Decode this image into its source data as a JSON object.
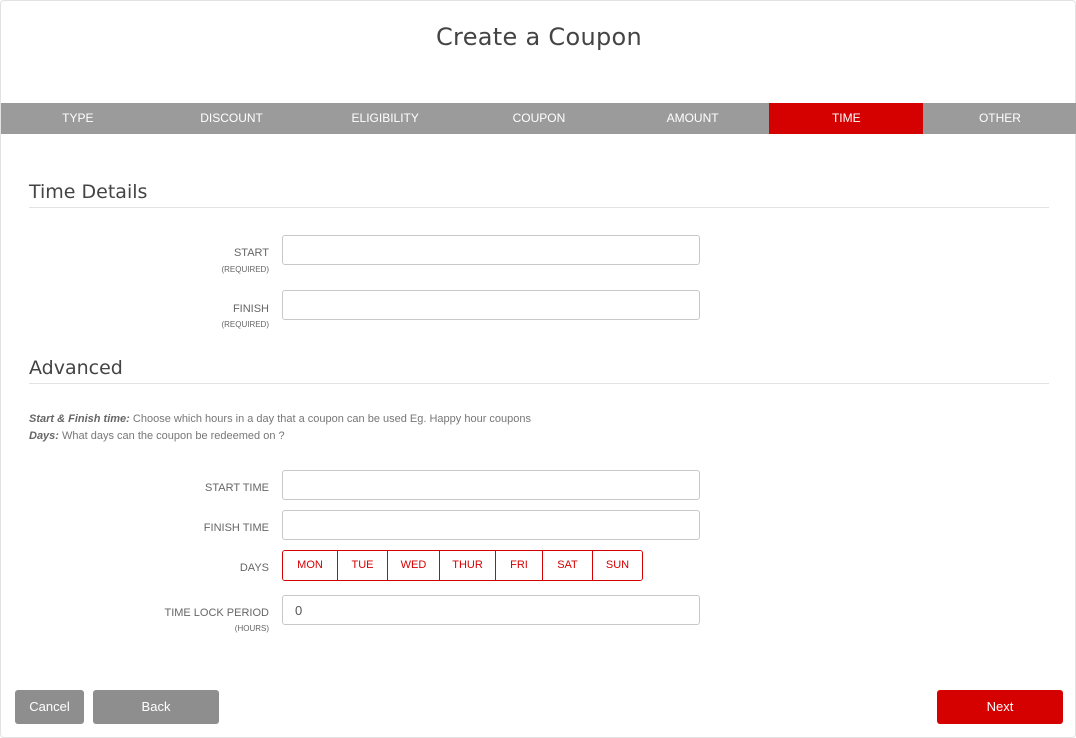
{
  "header": {
    "title": "Create a Coupon"
  },
  "steps": [
    {
      "label": "TYPE",
      "active": false
    },
    {
      "label": "DISCOUNT",
      "active": false
    },
    {
      "label": "ELIGIBILITY",
      "active": false
    },
    {
      "label": "COUPON",
      "active": false
    },
    {
      "label": "AMOUNT",
      "active": false
    },
    {
      "label": "TIME",
      "active": true
    },
    {
      "label": "OTHER",
      "active": false
    }
  ],
  "time_details": {
    "title": "Time Details",
    "start_label": "START",
    "start_sub": "(REQUIRED)",
    "start_value": "",
    "finish_label": "FINISH",
    "finish_sub": "(REQUIRED)",
    "finish_value": ""
  },
  "advanced": {
    "title": "Advanced",
    "help1_bold": "Start & Finish time:",
    "help1_text": " Choose which hours in a day that a coupon can be used Eg. Happy hour coupons",
    "help2_bold": "Days:",
    "help2_text": " What days can the coupon be redeemed on ?",
    "start_time_label": "START TIME",
    "start_time_value": "",
    "finish_time_label": "FINISH TIME",
    "finish_time_value": "",
    "days_label": "DAYS",
    "days": [
      "MON",
      "TUE",
      "WED",
      "THUR",
      "FRI",
      "SAT",
      "SUN"
    ],
    "lock_label": "TIME LOCK PERIOD",
    "lock_sub": "(HOURS)",
    "lock_value": "0"
  },
  "footer": {
    "cancel": "Cancel",
    "back": "Back",
    "next": "Next"
  },
  "colors": {
    "accent": "#d50000",
    "step_bg": "#9b9b9b",
    "button_gray": "#8e8e8e"
  }
}
